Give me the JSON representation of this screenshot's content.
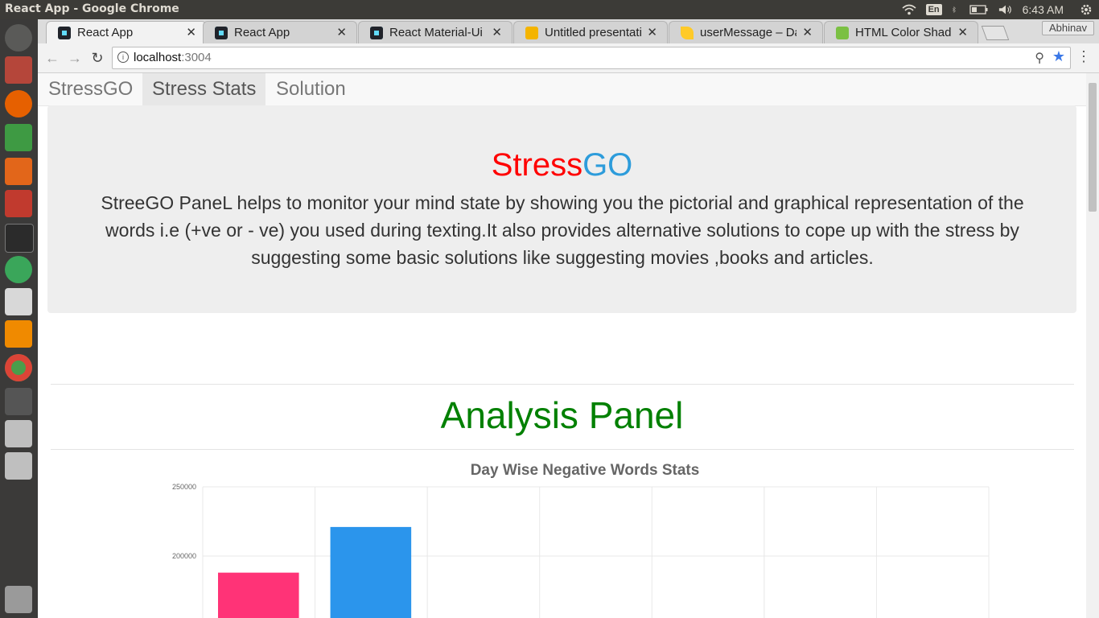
{
  "window": {
    "title": "React App - Google Chrome"
  },
  "tray": {
    "lang": "En",
    "clock": "6:43 AM"
  },
  "tabs": [
    {
      "label": "React App",
      "active": true
    },
    {
      "label": "React App",
      "active": false
    },
    {
      "label": "React Material-Ui K",
      "active": false
    },
    {
      "label": "Untitled presentati",
      "active": false
    },
    {
      "label": "userMessage – Data",
      "active": false
    },
    {
      "label": "HTML Color Shades",
      "active": false
    }
  ],
  "profile": "Abhinav",
  "omnibox": {
    "host": "localhost",
    "port": ":3004"
  },
  "appnav": {
    "brand": "StressGO",
    "stats": "Stress Stats",
    "solution": "Solution"
  },
  "jumbo": {
    "title_red": "Stress",
    "title_blue": "GO",
    "text": "StreeGO PaneL helps to monitor your mind state by showing you the pictorial and graphical representation of the words i.e (+ve or - ve) you used during texting.It also provides alternative solutions to cope up with the stress by suggesting some basic solutions like suggesting movies ,books and articles."
  },
  "analysis_title": "Analysis Panel",
  "chart_data": {
    "type": "bar",
    "title": "Day Wise Negative Words Stats",
    "ylabel": "",
    "xlabel": "",
    "ylim": [
      150000,
      250000
    ],
    "yticks": [
      250000,
      200000
    ],
    "ytick_labels": [
      "250000",
      "200000"
    ],
    "values": [
      188000,
      221000
    ],
    "colors": [
      "#ff3377",
      "#2b95ec"
    ],
    "grid": true
  },
  "colors": {
    "stress": "#ff0000",
    "go": "#2d9cdb",
    "analysis": "#008000"
  }
}
